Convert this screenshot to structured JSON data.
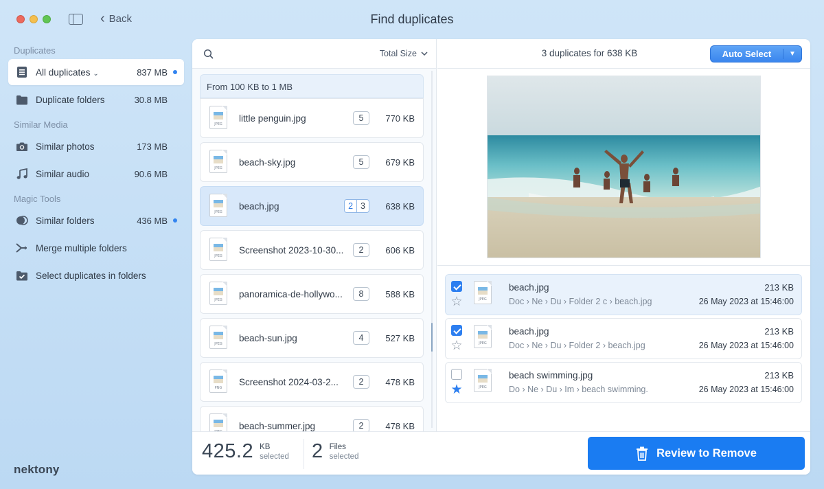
{
  "window": {
    "title": "Find duplicates",
    "back_label": "Back"
  },
  "sidebar": {
    "sections": [
      {
        "title": "Duplicates",
        "items": [
          {
            "label": "All duplicates",
            "size": "837 MB",
            "dot": true,
            "active": true,
            "icon": "document-list-icon"
          },
          {
            "label": "Duplicate folders",
            "size": "30.8 MB",
            "dot": false,
            "icon": "folder-icon"
          }
        ]
      },
      {
        "title": "Similar Media",
        "items": [
          {
            "label": "Similar photos",
            "size": "173 MB",
            "dot": false,
            "icon": "camera-icon"
          },
          {
            "label": "Similar audio",
            "size": "90.6 MB",
            "dot": false,
            "icon": "music-note-icon"
          }
        ]
      },
      {
        "title": "Magic Tools",
        "items": [
          {
            "label": "Similar folders",
            "size": "436 MB",
            "dot": true,
            "icon": "similar-folders-icon"
          },
          {
            "label": "Merge multiple folders",
            "size": "",
            "dot": false,
            "icon": "merge-icon"
          },
          {
            "label": "Select duplicates in folders",
            "size": "",
            "dot": false,
            "icon": "folder-check-icon"
          }
        ]
      }
    ],
    "logo": "nektony"
  },
  "file_list": {
    "sort_label": "Total Size",
    "group_header": "From 100 KB to 1 MB",
    "files": [
      {
        "name": "little penguin.jpg",
        "count": "5",
        "size": "770 KB",
        "ext": "JPEG"
      },
      {
        "name": "beach-sky.jpg",
        "count": "5",
        "size": "679 KB",
        "ext": "JPEG"
      },
      {
        "name": "beach.jpg",
        "count_selected": "2",
        "count": "3",
        "size": "638 KB",
        "ext": "JPEG",
        "selected": true
      },
      {
        "name": "Screenshot 2023-10-30...",
        "count": "2",
        "size": "606 KB",
        "ext": "JPEG"
      },
      {
        "name": "panoramica-de-hollywo...",
        "count": "8",
        "size": "588 KB",
        "ext": "JPEG"
      },
      {
        "name": "beach-sun.jpg",
        "count": "4",
        "size": "527 KB",
        "ext": "JPEG"
      },
      {
        "name": "Screenshot 2024-03-2...",
        "count": "2",
        "size": "478 KB",
        "ext": "PNG"
      },
      {
        "name": "beach-summer.jpg",
        "count": "2",
        "size": "478 KB",
        "ext": "JPEG"
      }
    ]
  },
  "detail": {
    "summary": "3 duplicates for 638 KB",
    "auto_select_label": "Auto Select",
    "duplicates": [
      {
        "name": "beach.jpg",
        "path": [
          "Doc",
          "Ne",
          "Du",
          "Folder 2 c",
          "beach.jpg"
        ],
        "size": "213 KB",
        "date": "26 May 2023 at 15:46:00",
        "checked": true,
        "starred": false
      },
      {
        "name": "beach.jpg",
        "path": [
          "Doc",
          "Ne",
          "Du",
          "Folder 2",
          "beach.jpg"
        ],
        "size": "213 KB",
        "date": "26 May 2023 at 15:46:00",
        "checked": true,
        "starred": false
      },
      {
        "name": "beach swimming.jpg",
        "path": [
          "Do",
          "Ne",
          "Du",
          "Im",
          "beach swimming."
        ],
        "size": "213 KB",
        "date": "26 May 2023 at 15:46:00",
        "checked": false,
        "starred": true
      }
    ]
  },
  "footer": {
    "size_value": "425.2",
    "size_unit": "KB",
    "size_caption": "selected",
    "files_value": "2",
    "files_unit": "Files",
    "files_caption": "selected",
    "review_label": "Review to Remove"
  },
  "colors": {
    "accent": "#1a7cf2",
    "dot": "#3284f0"
  }
}
